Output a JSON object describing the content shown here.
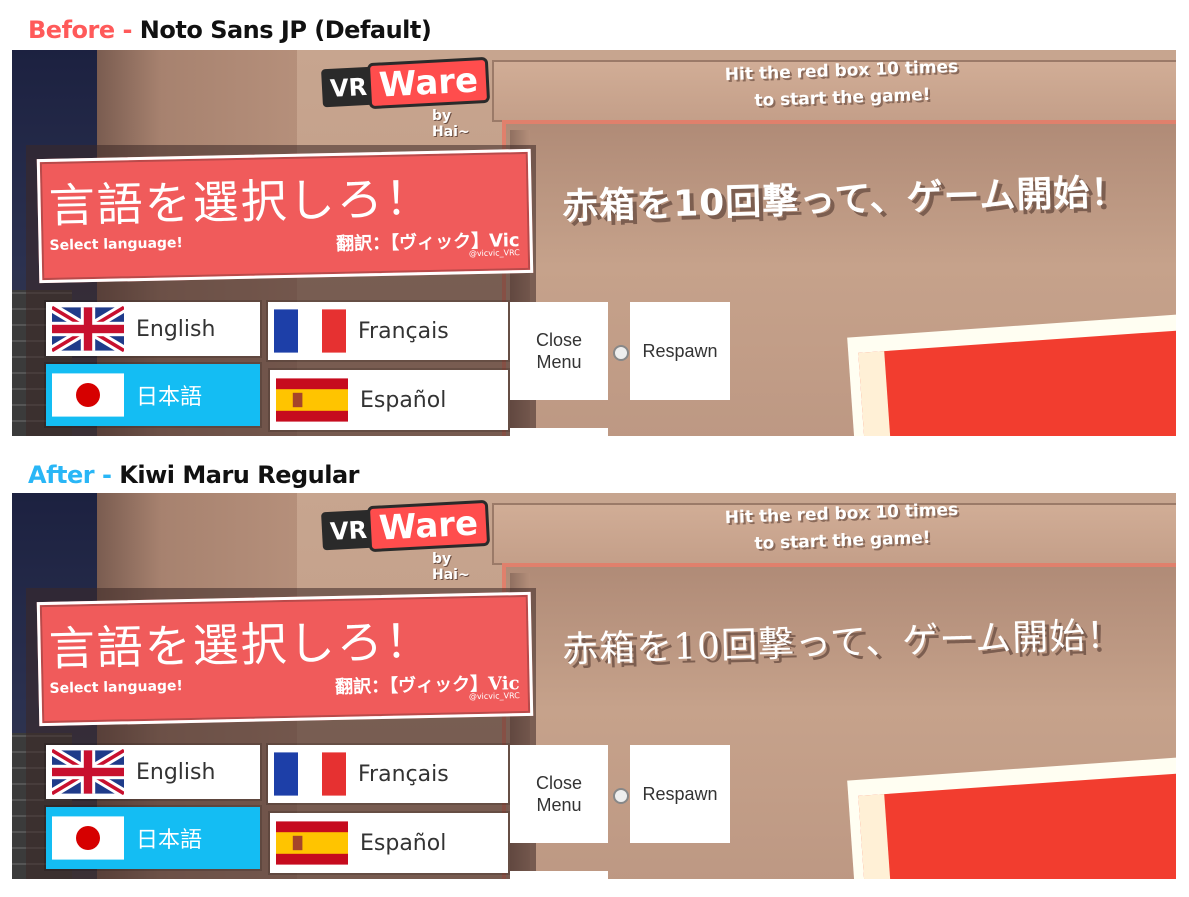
{
  "panels": [
    {
      "caption_tag": "Before -",
      "caption_font": "Noto Sans JP (Default)",
      "tag_color": "#ff5a5a"
    },
    {
      "caption_tag": "After -",
      "caption_font": "Kiwi Maru Regular",
      "tag_color": "#29b6f6"
    }
  ],
  "scene": {
    "logo_vr": "VR",
    "logo_ware": "Ware",
    "logo_by": "by Hai~",
    "hint_line1": "Hit the red box 10 times",
    "hint_line2": "to start the game!",
    "jp_hint": "赤箱を10回撃って、ゲーム開始！",
    "sign_title": "言語を選択しろ！",
    "sign_subtitle": "Select language!",
    "sign_translator": "翻訳：【ヴィック】Vic",
    "sign_handle": "@vicvic_VRC"
  },
  "languages": [
    {
      "label": "English",
      "flag": "uk-flag-icon"
    },
    {
      "label": "Français",
      "flag": "france-flag-icon"
    },
    {
      "label": "日本語",
      "flag": "japan-flag-icon",
      "selected": true
    },
    {
      "label": "Español",
      "flag": "spain-flag-icon"
    }
  ],
  "menu": {
    "close_line1": "Close",
    "close_line2": "Menu",
    "respawn": "Respawn"
  },
  "colors": {
    "sign_red": "#f05b5b",
    "selected_blue": "#14bdf3",
    "box_red": "#f23d2f"
  }
}
